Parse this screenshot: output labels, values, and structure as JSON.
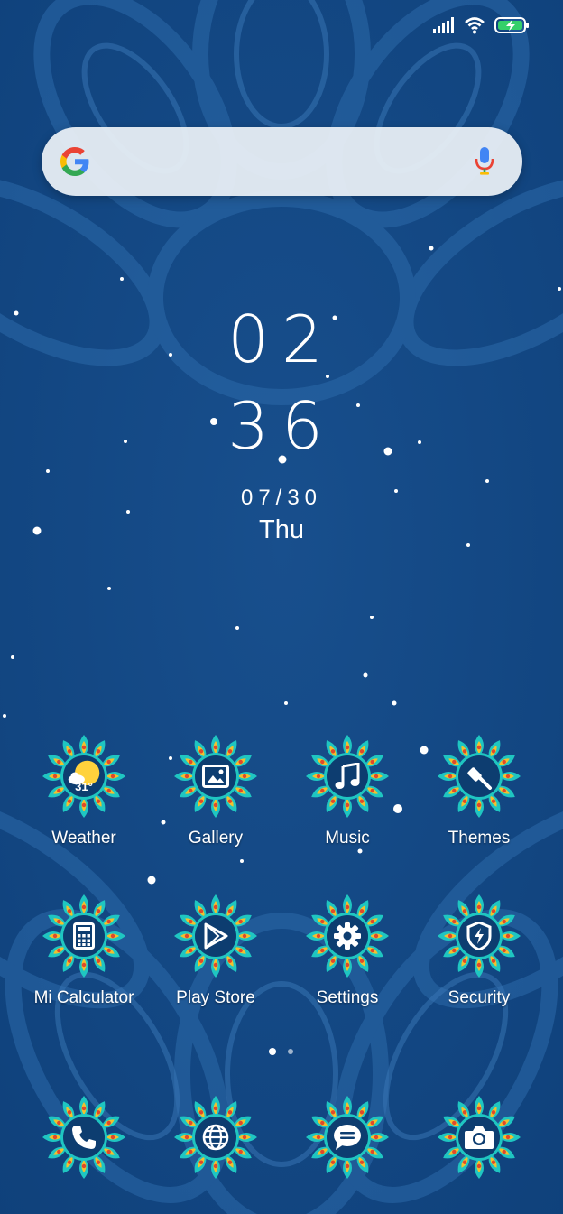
{
  "status_bar": {
    "signal_icon": "signal-bars-icon",
    "wifi_icon": "wifi-icon",
    "battery_icon": "battery-charging-icon",
    "battery_color": "#35d06a"
  },
  "search": {
    "logo": "google-g-icon",
    "mic": "mic-icon",
    "placeholder": ""
  },
  "clock": {
    "hours": "02",
    "minutes": "36",
    "date": "07/30",
    "weekday": "Thu"
  },
  "apps": [
    {
      "label": "Weather",
      "icon": "weather-icon",
      "temperature": "31°"
    },
    {
      "label": "Gallery",
      "icon": "gallery-icon"
    },
    {
      "label": "Music",
      "icon": "music-icon"
    },
    {
      "label": "Themes",
      "icon": "themes-icon"
    },
    {
      "label": "Mi Calculator",
      "icon": "calculator-icon"
    },
    {
      "label": "Play Store",
      "icon": "play-store-icon"
    },
    {
      "label": "Settings",
      "icon": "settings-icon"
    },
    {
      "label": "Security",
      "icon": "security-icon"
    }
  ],
  "dock": [
    {
      "name": "Phone",
      "icon": "phone-icon"
    },
    {
      "name": "Browser",
      "icon": "globe-icon"
    },
    {
      "name": "Messaging",
      "icon": "message-icon"
    },
    {
      "name": "Camera",
      "icon": "camera-icon"
    }
  ],
  "theme": {
    "background": "#124a86",
    "petal_teal": "#1fc6c1",
    "petal_gold": "#f2c12e",
    "icon_center": "#0d3d70"
  }
}
